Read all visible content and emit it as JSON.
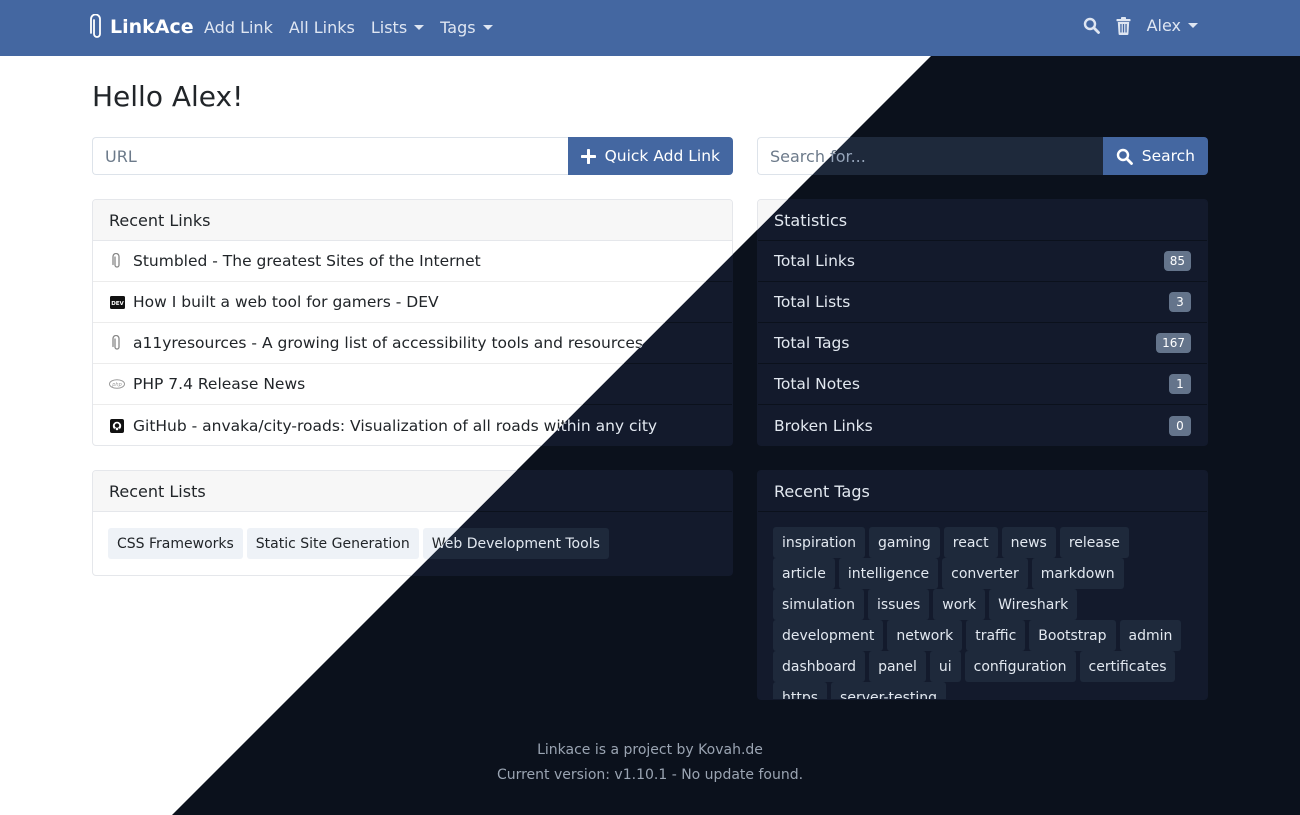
{
  "navbar": {
    "brand": "LinkAce",
    "links": [
      {
        "label": "Add Link",
        "dropdown": false
      },
      {
        "label": "All Links",
        "dropdown": false
      },
      {
        "label": "Lists",
        "dropdown": true
      },
      {
        "label": "Tags",
        "dropdown": true
      }
    ],
    "user": "Alex",
    "icons": [
      "search-icon",
      "trash-icon"
    ]
  },
  "greeting": "Hello Alex!",
  "quick_add": {
    "placeholder": "URL",
    "value": "",
    "button": "Quick Add Link"
  },
  "search": {
    "placeholder": "Search for...",
    "value": "",
    "button": "Search"
  },
  "recent_links": {
    "title": "Recent Links",
    "items": [
      {
        "icon": "paperclip-icon",
        "title": "Stumbled - The greatest Sites of the Internet"
      },
      {
        "icon": "dev-icon",
        "title": "How I built a web tool for gamers - DEV"
      },
      {
        "icon": "paperclip-icon",
        "title": "a11yresources - A growing list of accessibility tools and resources"
      },
      {
        "icon": "php-icon",
        "title": "PHP 7.4 Release News"
      },
      {
        "icon": "github-icon",
        "title": "GitHub - anvaka/city-roads: Visualization of all roads within any city"
      }
    ]
  },
  "recent_lists": {
    "title": "Recent Lists",
    "items": [
      "CSS Frameworks",
      "Static Site Generation",
      "Web Development Tools"
    ]
  },
  "statistics": {
    "title": "Statistics",
    "items": [
      {
        "label": "Total Links",
        "value": "85"
      },
      {
        "label": "Total Lists",
        "value": "3"
      },
      {
        "label": "Total Tags",
        "value": "167"
      },
      {
        "label": "Total Notes",
        "value": "1"
      },
      {
        "label": "Broken Links",
        "value": "0"
      }
    ]
  },
  "recent_tags": {
    "title": "Recent Tags",
    "items": [
      "inspiration",
      "gaming",
      "react",
      "news",
      "release",
      "article",
      "intelligence",
      "converter",
      "markdown",
      "simulation",
      "issues",
      "work",
      "Wireshark",
      "development",
      "network",
      "traffic",
      "Bootstrap",
      "admin",
      "dashboard",
      "panel",
      "ui",
      "configuration",
      "certificates",
      "https",
      "server-testing"
    ]
  },
  "footer": {
    "line1": "Linkace is a project by Kovah.de",
    "line2": "Current version: v1.10.1 - No update found."
  },
  "colors": {
    "brand": "#4467a1",
    "dark_bg": "#0b111c",
    "dark_card": "#131a2c",
    "dark_input": "#1e293b"
  }
}
